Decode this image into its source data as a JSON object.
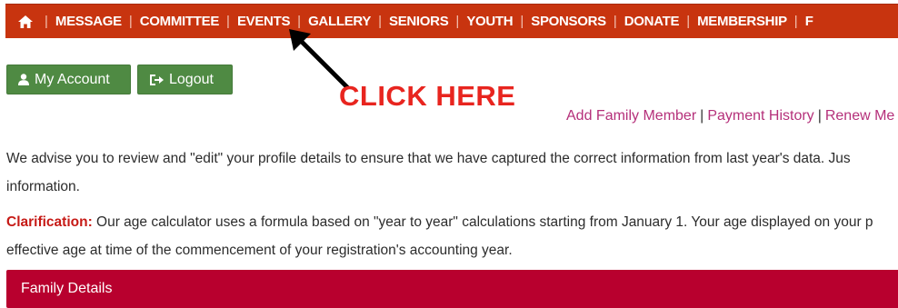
{
  "nav": {
    "home_icon": "home-icon",
    "items": [
      "MESSAGE",
      "COMMITTEE",
      "EVENTS",
      "GALLERY",
      "SENIORS",
      "YOUTH",
      "SPONSORS",
      "DONATE",
      "MEMBERSHIP",
      "F"
    ]
  },
  "buttons": {
    "account_label": "My Account",
    "account_icon": "user-icon",
    "logout_label": "Logout",
    "logout_icon": "logout-icon"
  },
  "annotation": {
    "text": "CLICK HERE",
    "color": "#e8251f"
  },
  "links": {
    "add_family": "Add Family Member",
    "payment_history": "Payment History",
    "renew": "Renew Me",
    "separator": "|"
  },
  "notice": {
    "line1": "We advise you to review and \"edit\" your profile details to ensure that we have captured the correct information from last year's data. Jus",
    "line2": "information.",
    "clar_label": "Clarification:",
    "clar_line1": " Our age calculator uses a formula based on \"year to year\" calculations starting from January 1. Your age displayed on your p",
    "clar_line2": "effective age at time of the commencement of your registration's accounting year."
  },
  "section": {
    "family_title": "Family Details"
  },
  "colors": {
    "nav_bg": "#c8340f",
    "button_green": "#4f8a43",
    "section_bar": "#b8002e",
    "link": "#b5307a"
  }
}
